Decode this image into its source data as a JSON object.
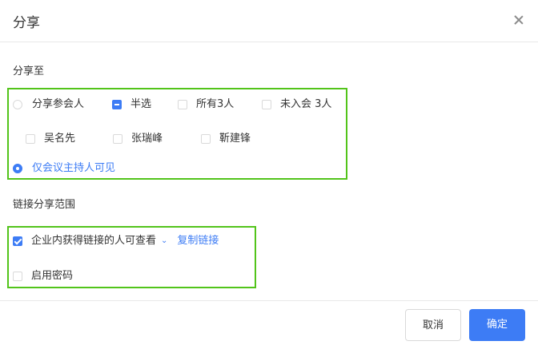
{
  "dialog": {
    "title": "分享"
  },
  "share_to": {
    "label": "分享至",
    "options": {
      "participants": "分享参会人",
      "half_select": "半选",
      "all": "所有3人",
      "not_joined": "未入会 3人"
    },
    "people": [
      "吴名先",
      "张瑞峰",
      "靳建锋"
    ],
    "host_only": "仅会议主持人可见"
  },
  "link_scope": {
    "label": "链接分享范围",
    "enterprise_option": "企业内获得链接的人可查看",
    "copy_link": "复制链接",
    "enable_password": "启用密码"
  },
  "footer": {
    "cancel": "取消",
    "confirm": "确定"
  },
  "colors": {
    "accent": "#3d7cf5",
    "highlight_border": "#52c41a"
  }
}
